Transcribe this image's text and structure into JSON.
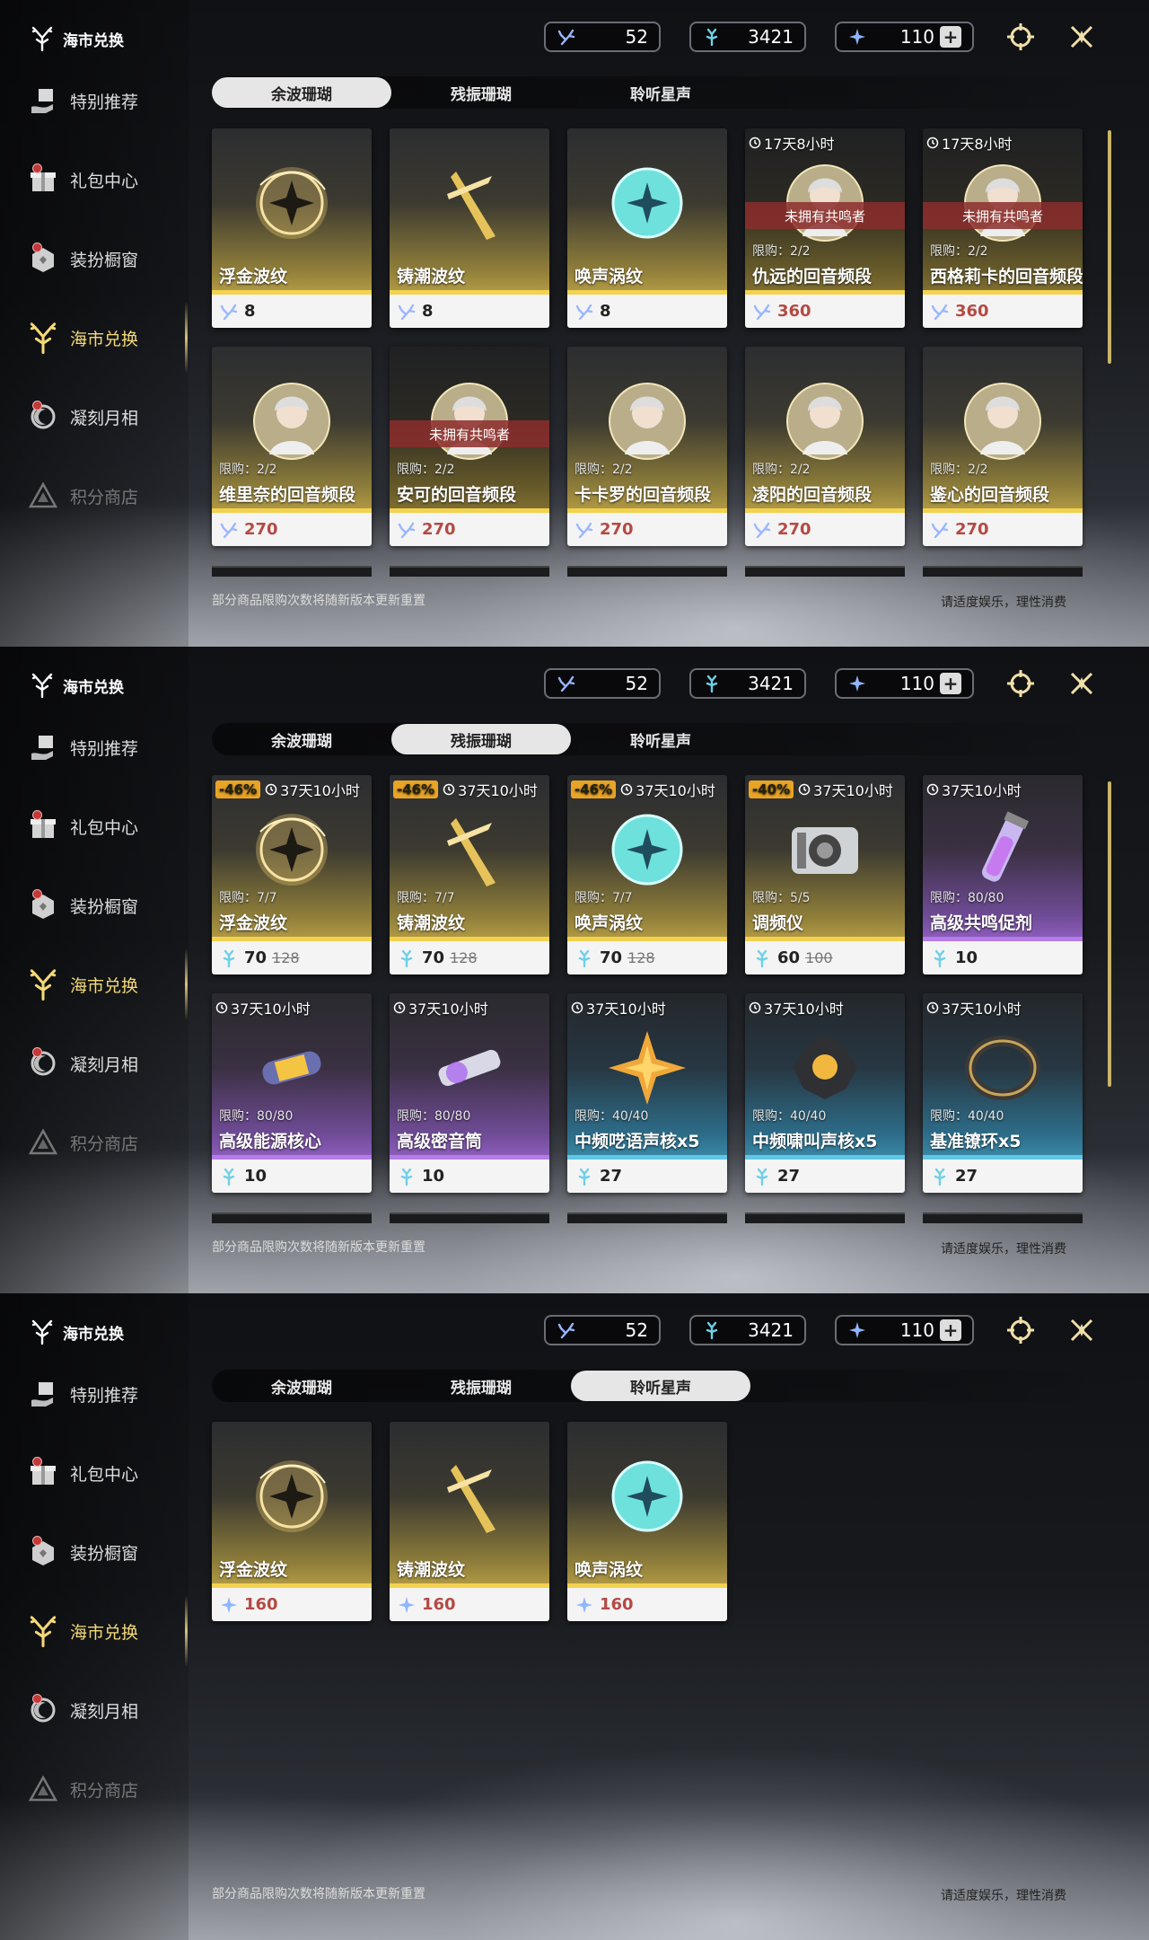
{
  "common": {
    "brand": "海市兑换",
    "nav": [
      {
        "label": "特别推荐",
        "icon": "hand-gift-icon",
        "dot": false,
        "state": "normal"
      },
      {
        "label": "礼包中心",
        "icon": "gift-box-icon",
        "dot": true,
        "state": "normal"
      },
      {
        "label": "装扮橱窗",
        "icon": "outfit-box-icon",
        "dot": true,
        "state": "normal"
      },
      {
        "label": "海市兑换",
        "icon": "coral-icon",
        "dot": false,
        "state": "active"
      },
      {
        "label": "凝刻月相",
        "icon": "moon-emblem-icon",
        "dot": true,
        "state": "normal"
      },
      {
        "label": "积分商店",
        "icon": "triangle-emblem-icon",
        "dot": false,
        "state": "dim"
      }
    ],
    "currencies": [
      {
        "icon": "afterglow-coral-icon",
        "value": "52"
      },
      {
        "icon": "oscillated-coral-icon",
        "value": "3421"
      },
      {
        "icon": "lustrous-tide-icon",
        "value": "110"
      }
    ],
    "tabs": [
      "余波珊瑚",
      "残振珊瑚",
      "聆听星声"
    ],
    "footer_left": "部分商品限购次数将随新版本更新重置",
    "footer_right": "请适度娱乐，理性消费",
    "colors": {
      "accent": "#f4d977",
      "gold": "#f2d24f",
      "purple": "#b47be9",
      "blue": "#5fc6e6",
      "discount": "#e9a427",
      "ban": "#8c2d2d"
    }
  },
  "panels": [
    {
      "selected_tab": 0,
      "cards": [
        {
          "name": "浮金波纹",
          "price": "8",
          "rarity": "gold",
          "icon": "gold-orb-icon",
          "price_icon": "afterglow-coral-icon"
        },
        {
          "name": "铸潮波纹",
          "price": "8",
          "rarity": "gold",
          "icon": "gold-blade-icon",
          "price_icon": "afterglow-coral-icon"
        },
        {
          "name": "唤声涡纹",
          "price": "8",
          "rarity": "gold",
          "icon": "teal-orb-icon",
          "price_icon": "afterglow-coral-icon"
        },
        {
          "name": "仇远的回音频段",
          "price": "360",
          "rarity": "gold",
          "icon": "portrait-icon",
          "timer": "17天8小时",
          "limit": "限购：2/2",
          "banner": "未拥有共鸣者",
          "red": true,
          "price_icon": "afterglow-coral-icon"
        },
        {
          "name": "西格莉卡的回音频段",
          "price": "360",
          "rarity": "gold",
          "icon": "portrait-icon",
          "timer": "17天8小时",
          "limit": "限购：2/2",
          "banner": "未拥有共鸣者",
          "red": true,
          "price_icon": "afterglow-coral-icon"
        },
        {
          "name": "维里奈的回音频段",
          "price": "270",
          "rarity": "gold",
          "icon": "portrait-icon",
          "limit": "限购：2/2",
          "red": true,
          "price_icon": "afterglow-coral-icon"
        },
        {
          "name": "安可的回音频段",
          "price": "270",
          "rarity": "gold",
          "icon": "portrait-icon",
          "limit": "限购：2/2",
          "banner": "未拥有共鸣者",
          "red": true,
          "price_icon": "afterglow-coral-icon"
        },
        {
          "name": "卡卡罗的回音频段",
          "price": "270",
          "rarity": "gold",
          "icon": "portrait-icon",
          "limit": "限购：2/2",
          "red": true,
          "price_icon": "afterglow-coral-icon"
        },
        {
          "name": "凌阳的回音频段",
          "price": "270",
          "rarity": "gold",
          "icon": "portrait-icon",
          "limit": "限购：2/2",
          "red": true,
          "price_icon": "afterglow-coral-icon"
        },
        {
          "name": "鉴心的回音频段",
          "price": "270",
          "rarity": "gold",
          "icon": "portrait-icon",
          "limit": "限购：2/2",
          "red": true,
          "price_icon": "afterglow-coral-icon"
        }
      ]
    },
    {
      "selected_tab": 1,
      "cards": [
        {
          "name": "浮金波纹",
          "price": "70",
          "old": "128",
          "rarity": "gold",
          "icon": "gold-orb-icon",
          "timer": "37天10小时",
          "discount": "-46%",
          "limit": "限购：7/7",
          "price_icon": "oscillated-coral-icon"
        },
        {
          "name": "铸潮波纹",
          "price": "70",
          "old": "128",
          "rarity": "gold",
          "icon": "gold-blade-icon",
          "timer": "37天10小时",
          "discount": "-46%",
          "limit": "限购：7/7",
          "price_icon": "oscillated-coral-icon"
        },
        {
          "name": "唤声涡纹",
          "price": "70",
          "old": "128",
          "rarity": "gold",
          "icon": "teal-orb-icon",
          "timer": "37天10小时",
          "discount": "-46%",
          "limit": "限购：7/7",
          "price_icon": "oscillated-coral-icon"
        },
        {
          "name": "调频仪",
          "price": "60",
          "old": "100",
          "rarity": "gold",
          "icon": "tuner-device-icon",
          "timer": "37天10小时",
          "discount": "-40%",
          "limit": "限购：5/5",
          "price_icon": "oscillated-coral-icon"
        },
        {
          "name": "高级共鸣促剂",
          "price": "10",
          "rarity": "purple",
          "icon": "vial-icon",
          "timer": "37天10小时",
          "limit": "限购：80/80",
          "price_icon": "oscillated-coral-icon"
        },
        {
          "name": "高级能源核心",
          "price": "10",
          "rarity": "purple",
          "icon": "energy-core-icon",
          "timer": "37天10小时",
          "limit": "限购：80/80",
          "price_icon": "oscillated-coral-icon"
        },
        {
          "name": "高级密音筒",
          "price": "10",
          "rarity": "purple",
          "icon": "sealed-tube-icon",
          "timer": "37天10小时",
          "limit": "限购：80/80",
          "price_icon": "oscillated-coral-icon"
        },
        {
          "name": "中频呓语声核x5",
          "price": "27",
          "rarity": "blue",
          "icon": "gold-star-icon",
          "timer": "37天10小时",
          "limit": "限购：40/40",
          "price_icon": "oscillated-coral-icon"
        },
        {
          "name": "中频啸叫声核x5",
          "price": "27",
          "rarity": "blue",
          "icon": "dark-core-icon",
          "timer": "37天10小时",
          "limit": "限购：40/40",
          "price_icon": "oscillated-coral-icon"
        },
        {
          "name": "基准镣环x5",
          "price": "27",
          "rarity": "blue",
          "icon": "ring-icon",
          "timer": "37天10小时",
          "limit": "限购：40/40",
          "price_icon": "oscillated-coral-icon"
        }
      ]
    },
    {
      "selected_tab": 2,
      "cards": [
        {
          "name": "浮金波纹",
          "price": "160",
          "rarity": "gold",
          "icon": "gold-orb-icon",
          "red": true,
          "price_icon": "lustrous-tide-icon"
        },
        {
          "name": "铸潮波纹",
          "price": "160",
          "rarity": "gold",
          "icon": "gold-blade-icon",
          "red": true,
          "price_icon": "lustrous-tide-icon"
        },
        {
          "name": "唤声涡纹",
          "price": "160",
          "rarity": "gold",
          "icon": "teal-orb-icon",
          "red": true,
          "price_icon": "lustrous-tide-icon"
        }
      ]
    }
  ]
}
